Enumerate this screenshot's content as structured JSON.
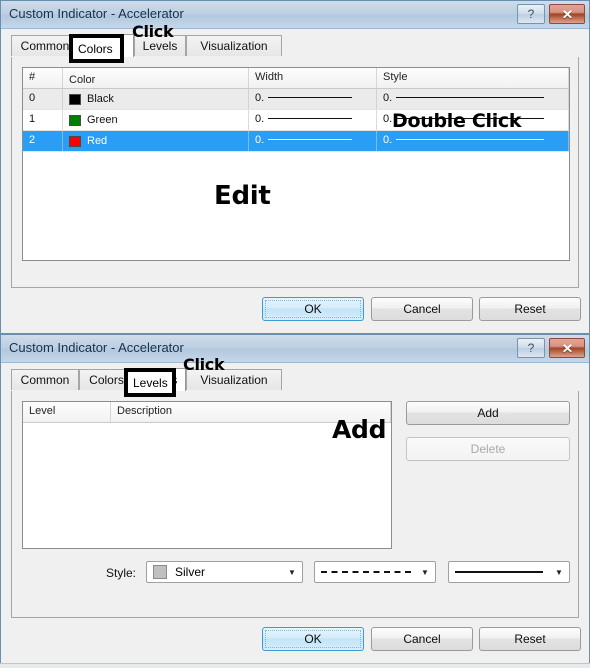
{
  "dialogs": [
    {
      "title": "Custom Indicator - Accelerator",
      "help_label": "?",
      "close_label": "✕",
      "tabs": [
        {
          "label": "Common",
          "selected": false
        },
        {
          "label": "Colors",
          "selected": true
        },
        {
          "label": "Levels",
          "selected": false
        },
        {
          "label": "Visualization",
          "selected": false
        }
      ],
      "table": {
        "columns": [
          "#",
          "Color",
          "Width",
          "Style"
        ],
        "rows": [
          {
            "index": "0",
            "color_name": "Black",
            "color_hex": "#000000",
            "width": "0.",
            "style": "0.",
            "selected": false
          },
          {
            "index": "1",
            "color_name": "Green",
            "color_hex": "#008000",
            "width": "0.",
            "style": "0.",
            "selected": false
          },
          {
            "index": "2",
            "color_name": "Red",
            "color_hex": "#ff0000",
            "width": "0.",
            "style": "0.",
            "selected": true
          }
        ]
      },
      "buttons": {
        "ok": "OK",
        "cancel": "Cancel",
        "reset": "Reset"
      },
      "annotations": {
        "click": "Click",
        "double_click": "Double Click",
        "edit": "Edit"
      }
    },
    {
      "title": "Custom Indicator - Accelerator",
      "help_label": "?",
      "close_label": "✕",
      "tabs": [
        {
          "label": "Common",
          "selected": false
        },
        {
          "label": "Colors",
          "selected": false
        },
        {
          "label": "Levels",
          "selected": true
        },
        {
          "label": "Visualization",
          "selected": false
        }
      ],
      "levels_table": {
        "columns": [
          "Level",
          "Description"
        ],
        "rows": []
      },
      "side_buttons": {
        "add": "Add",
        "delete": "Delete"
      },
      "style_row": {
        "label": "Style:",
        "color_value": "Silver",
        "color_hex": "#c0c0c0",
        "line_style_value": "dashed",
        "line_width_value": "solid"
      },
      "buttons": {
        "ok": "OK",
        "cancel": "Cancel",
        "reset": "Reset"
      },
      "annotations": {
        "click": "Click",
        "add": "Add"
      }
    }
  ],
  "theme": {
    "titlebar": "#bdcfe2",
    "selection": "#2a9df4",
    "close_red": "#b05b38",
    "accent_blue": "#3c9ad4"
  }
}
